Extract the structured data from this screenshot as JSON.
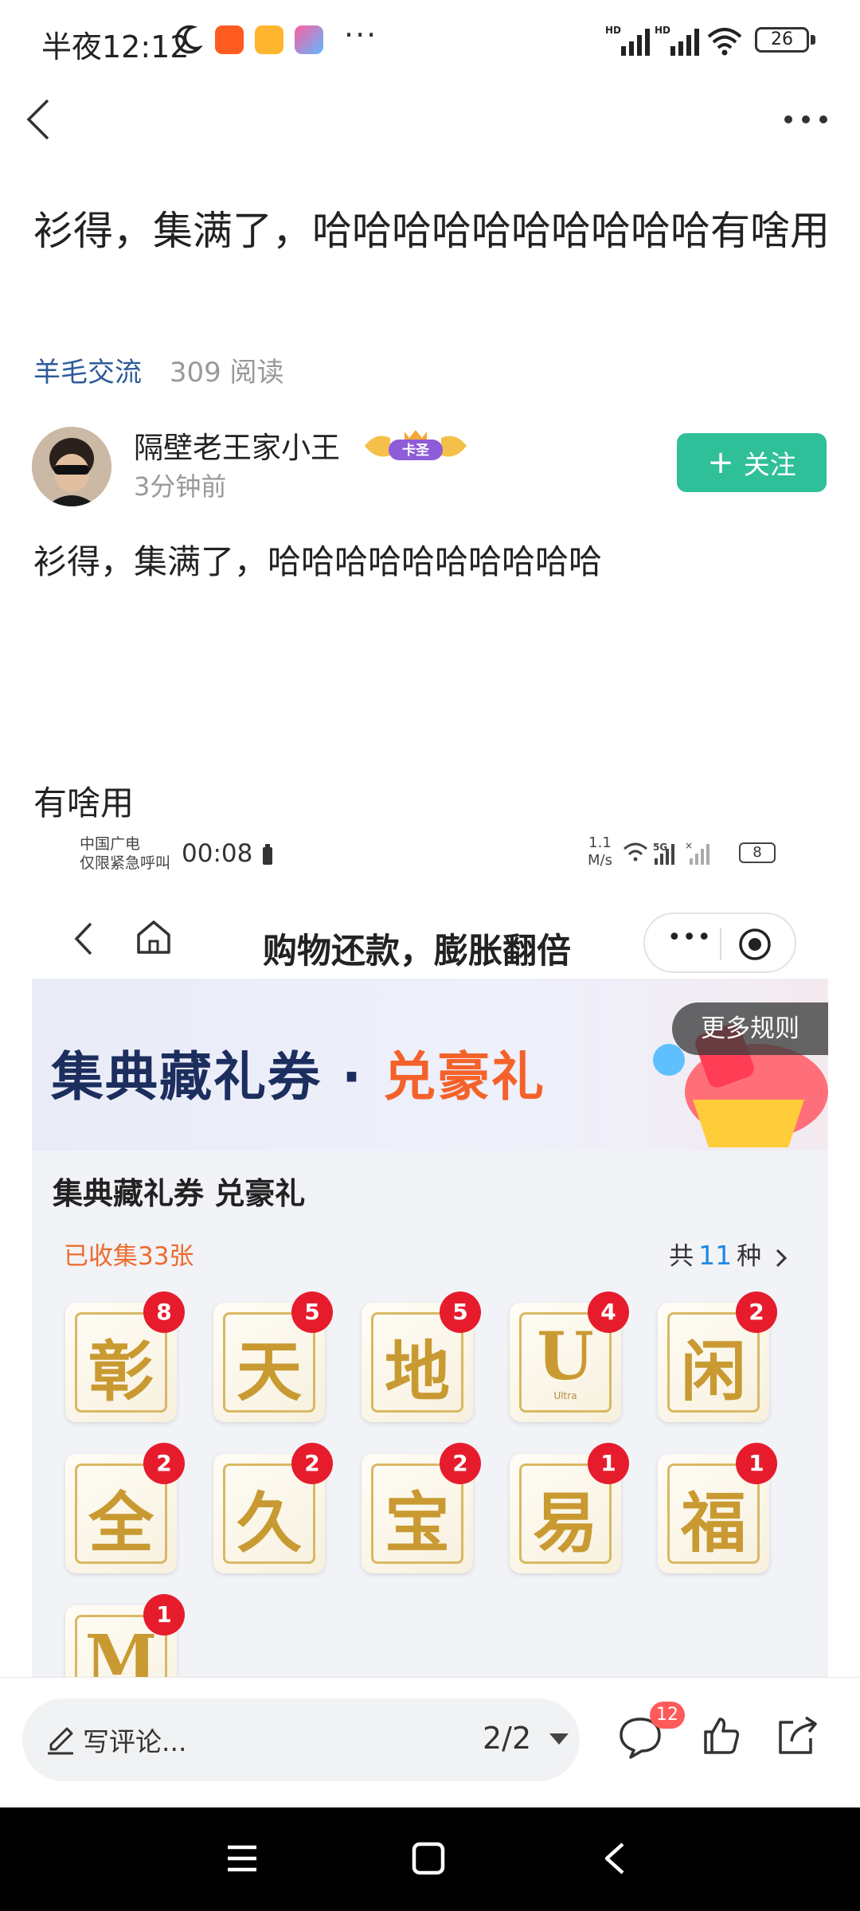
{
  "status_bar": {
    "time": "半夜12:12",
    "overflow": "···",
    "battery": "26",
    "network_left": "HD",
    "network_right": "HD"
  },
  "post": {
    "title": "衫得，集满了，哈哈哈哈哈哈哈哈哈哈有啥用",
    "category": "羊毛交流",
    "reads": "309 阅读",
    "author": "隔壁老王家小王",
    "author_badge": "卡圣",
    "time_ago": "3分钟前",
    "follow_label": "关注",
    "paragraph_1": "衫得，集满了，哈哈哈哈哈哈哈哈哈哈",
    "paragraph_2": "有啥用"
  },
  "embedded": {
    "carrier_line1": "中国广电",
    "carrier_line2": "仅限紧急呼叫",
    "time": "00:08",
    "speed_value": "1.1",
    "speed_unit": "M/s",
    "network": "5G",
    "battery": "8",
    "page_title": "购物还款，膨胀翻倍",
    "banner_left": "集典藏礼券 · ",
    "banner_right": "兑豪礼",
    "rules_label": "更多规则",
    "section_title": "集典藏礼券 兑豪礼",
    "collected": "已收集33张",
    "total_prefix": "共",
    "total_num": "11",
    "total_suffix": "种",
    "cards": [
      {
        "glyph": "彰",
        "count": "8"
      },
      {
        "glyph": "天",
        "count": "5"
      },
      {
        "glyph": "地",
        "count": "5"
      },
      {
        "glyph": "U",
        "count": "4",
        "sub": "Ultra"
      },
      {
        "glyph": "闲",
        "count": "2"
      },
      {
        "glyph": "全",
        "count": "2"
      },
      {
        "glyph": "久",
        "count": "2"
      },
      {
        "glyph": "宝",
        "count": "2"
      },
      {
        "glyph": "易",
        "count": "1"
      },
      {
        "glyph": "福",
        "count": "1"
      },
      {
        "glyph": "M",
        "count": "1"
      }
    ]
  },
  "comment_bar": {
    "placeholder": "写评论...",
    "page_indicator": "2/2",
    "comment_count": "12"
  },
  "colors": {
    "accent_green": "#2fbf99",
    "category_blue": "#2d5b9a",
    "badge_red": "#e61c2d",
    "orange": "#ee6b2e"
  }
}
